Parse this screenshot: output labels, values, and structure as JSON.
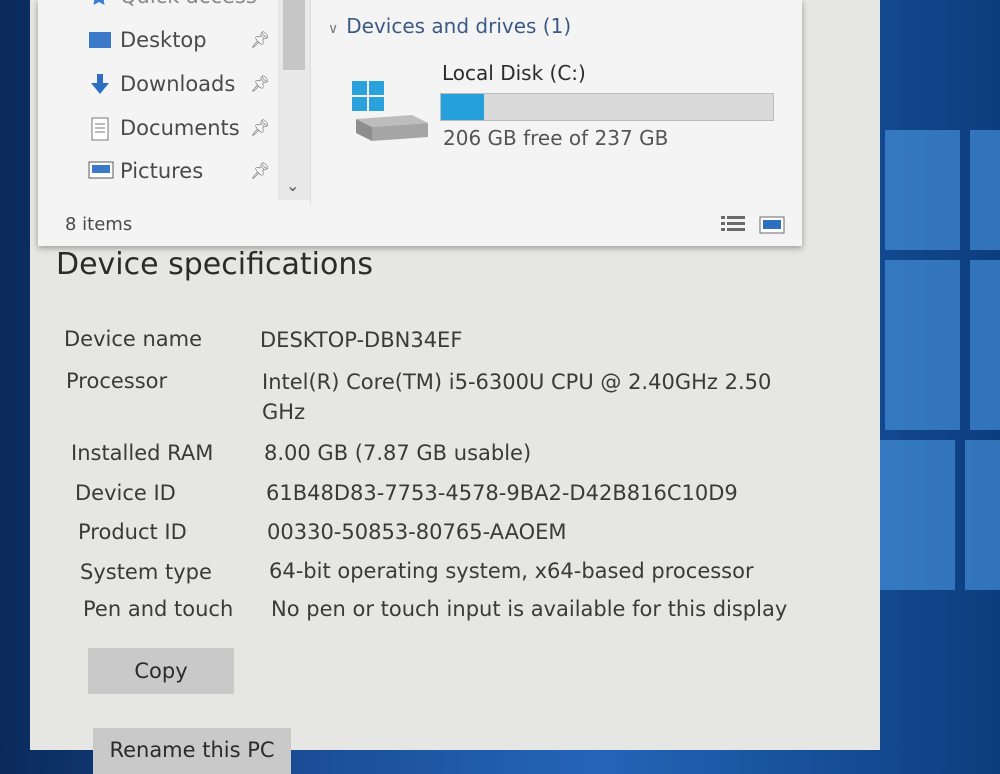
{
  "explorer": {
    "quick_access_label": "Quick access",
    "nav_items": [
      {
        "label": "Desktop",
        "icon": "desktop-icon"
      },
      {
        "label": "Downloads",
        "icon": "download-arrow-icon"
      },
      {
        "label": "Documents",
        "icon": "document-icon"
      },
      {
        "label": "Pictures",
        "icon": "pictures-icon"
      }
    ],
    "section_title": "Devices and drives (1)",
    "drive": {
      "name": "Local Disk (C:)",
      "free_text": "206 GB free of 237 GB",
      "used_fraction": 0.13,
      "icon": "windows-drive-icon"
    },
    "status": "8 items",
    "view_icons": [
      "details-view-icon",
      "large-icons-view-icon"
    ],
    "colors": {
      "accent": "#26a0da"
    }
  },
  "device_specifications": {
    "title": "Device specifications",
    "rows": [
      {
        "label": "Device name",
        "value": "DESKTOP-DBN34EF"
      },
      {
        "label": "Processor",
        "value": "Intel(R) Core(TM) i5-6300U CPU @ 2.40GHz   2.50 GHz"
      },
      {
        "label": "Installed RAM",
        "value": "8.00 GB (7.87 GB usable)"
      },
      {
        "label": "Device ID",
        "value": "61B48D83-7753-4578-9BA2-D42B816C10D9"
      },
      {
        "label": "Product ID",
        "value": "00330-50853-80765-AAOEM"
      },
      {
        "label": "System type",
        "value": "64-bit operating system, x64-based processor"
      },
      {
        "label": "Pen and touch",
        "value": "No pen or touch input is available for this display"
      }
    ],
    "copy_label": "Copy",
    "rename_label": "Rename this PC"
  }
}
